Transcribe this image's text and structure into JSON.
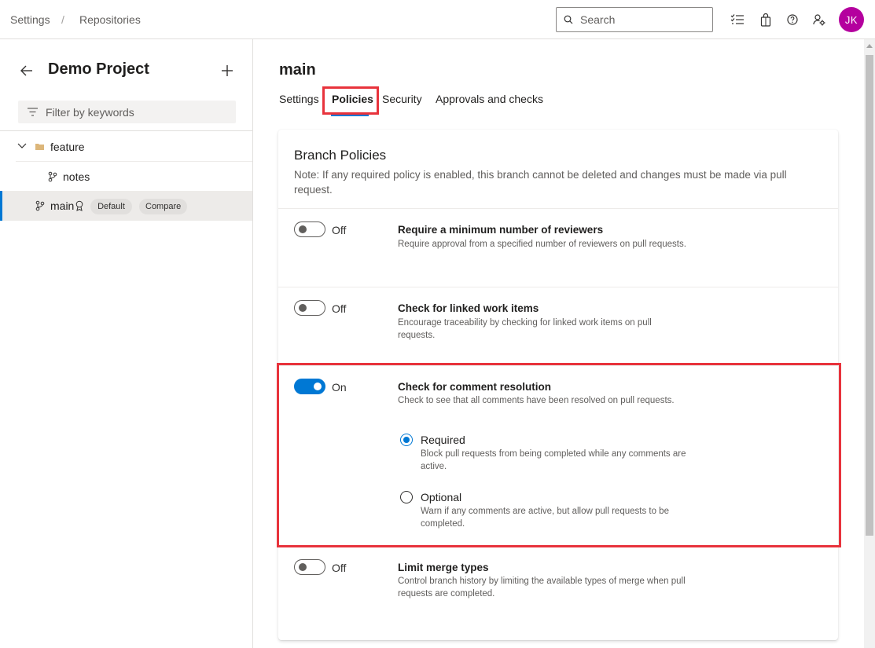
{
  "breadcrumb": {
    "settings": "Settings",
    "separator": "/",
    "repositories": "Repositories"
  },
  "search": {
    "placeholder": "Search"
  },
  "user": {
    "initials": "JK",
    "avatar_color": "#b4009e"
  },
  "sidebar": {
    "project_name": "Demo Project",
    "filter_placeholder": "Filter by keywords",
    "tree": {
      "folder": "feature",
      "child": "notes",
      "main": "main",
      "default_badge": "Default",
      "compare_badge": "Compare"
    }
  },
  "main": {
    "branch": "main",
    "tabs": {
      "settings": "Settings",
      "policies": "Policies",
      "security": "Security",
      "approvals": "Approvals and checks"
    }
  },
  "policies": {
    "title": "Branch Policies",
    "note": "Note: If any required policy is enabled, this branch cannot be deleted and changes must be made via pull request.",
    "reviewers": {
      "state": "Off",
      "title": "Require a minimum number of reviewers",
      "desc": "Require approval from a specified number of reviewers on pull requests."
    },
    "work_items": {
      "state": "Off",
      "title": "Check for linked work items",
      "desc": "Encourage traceability by checking for linked work items on pull requests."
    },
    "comments": {
      "state": "On",
      "title": "Check for comment resolution",
      "desc": "Check to see that all comments have been resolved on pull requests.",
      "required_label": "Required",
      "required_desc": "Block pull requests from being completed while any comments are active.",
      "optional_label": "Optional",
      "optional_desc": "Warn if any comments are active, but allow pull requests to be completed."
    },
    "merge_types": {
      "state": "Off",
      "title": "Limit merge types",
      "desc": "Control branch history by limiting the available types of merge when pull requests are completed."
    }
  },
  "colors": {
    "accent": "#0078d4",
    "highlight": "#e8333c"
  }
}
